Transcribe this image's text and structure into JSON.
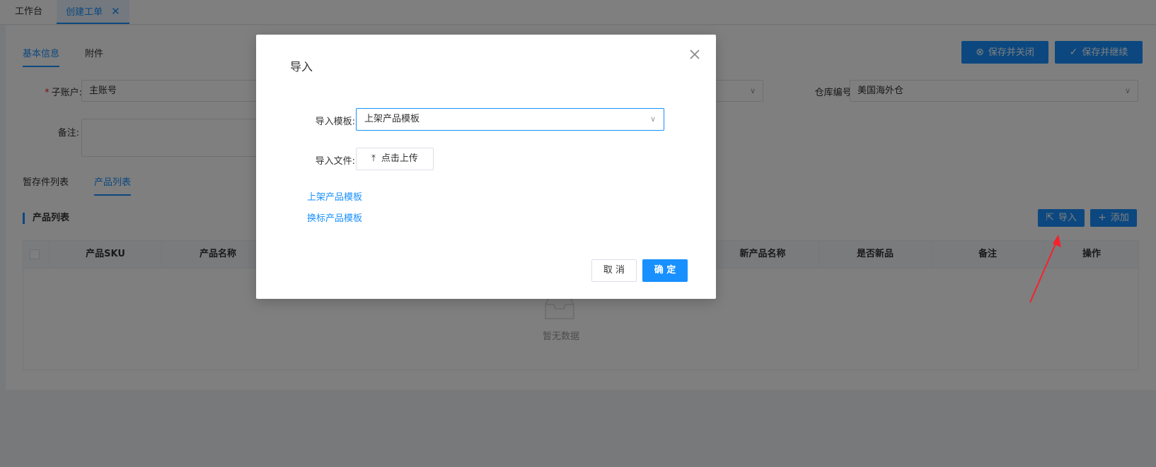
{
  "tabs": [
    {
      "label": "工作台",
      "active": false
    },
    {
      "label": "创建工单",
      "active": true
    }
  ],
  "subtabs": {
    "basic_info": "基本信息",
    "attachments": "附件"
  },
  "actions": {
    "save_close": "保存并关闭",
    "save_continue": "保存并继续"
  },
  "form": {
    "sub_account_label": "子账户:",
    "sub_account_value": "主账号",
    "warehouse_label": "仓库编号:",
    "warehouse_value": "美国海外仓",
    "remark_label": "备注:"
  },
  "list_tabs": {
    "staging": "暂存件列表",
    "products": "产品列表"
  },
  "section_title": "产品列表",
  "table_buttons": {
    "import": "导入",
    "add": "添加"
  },
  "table": {
    "headers": [
      "产品SKU",
      "产品名称",
      "新产品名称",
      "是否新品",
      "备注",
      "操作"
    ],
    "empty_text": "暂无数据"
  },
  "dialog": {
    "title": "导入",
    "template_label": "导入模板:",
    "template_value": "上架产品模板",
    "file_label": "导入文件:",
    "upload_label": "点击上传",
    "links": [
      "上架产品模板",
      "换标产品模板"
    ],
    "cancel_label": "取 消",
    "ok_label": "确 定"
  },
  "colors": {
    "primary": "#1890ff",
    "annotation_arrow": "#f5222d"
  },
  "icons": {
    "close": "close-icon",
    "upload": "upload-icon",
    "import": "import-icon",
    "add": "plus-icon",
    "save_close": "circle-x-icon",
    "save_continue": "circle-check-icon",
    "empty": "empty-inbox-icon"
  }
}
